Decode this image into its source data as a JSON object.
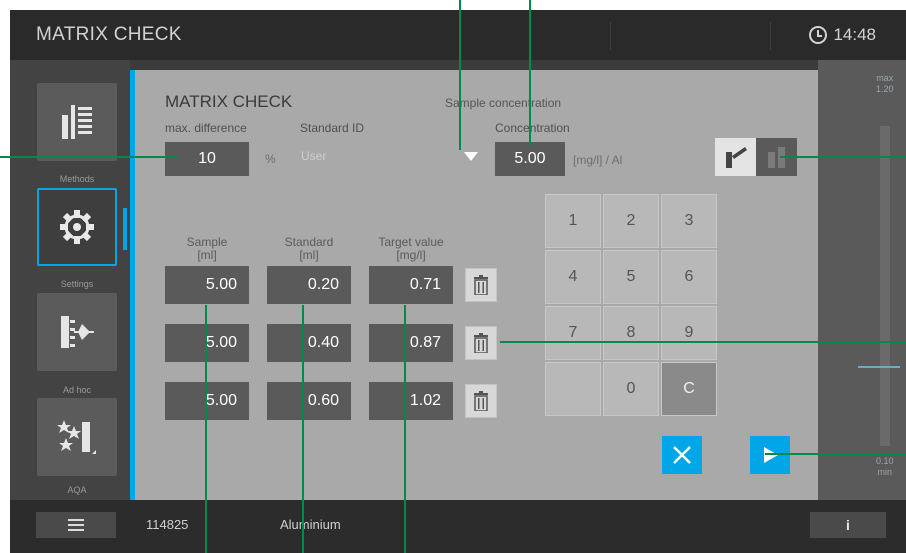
{
  "header": {
    "title": "MATRIX CHECK",
    "time": "14:48"
  },
  "sidebar": {
    "items": [
      {
        "label": "Methods",
        "icon": "methods-icon"
      },
      {
        "label": "Settings",
        "icon": "gear-icon"
      },
      {
        "label": "Ad hoc",
        "icon": "ad-hoc-icon"
      },
      {
        "label": "AQA",
        "icon": "aqa-icon"
      }
    ]
  },
  "panel": {
    "title": "MATRIX CHECK",
    "section": "Sample concentration",
    "max_difference": {
      "label": "max. difference",
      "value": "10",
      "unit": "%"
    },
    "standard_id": {
      "label": "Standard ID",
      "value": "User"
    },
    "concentration": {
      "label": "Concentration",
      "value": "5.00",
      "unit": "[mg/l] / Al"
    },
    "columns": [
      {
        "label": "Sample",
        "unit": "[ml]"
      },
      {
        "label": "Standard",
        "unit": "[ml]"
      },
      {
        "label": "Target value",
        "unit": "[mg/l]"
      }
    ],
    "rows": [
      {
        "sample": "5.00",
        "standard": "0.20",
        "target": "0.71"
      },
      {
        "sample": "5.00",
        "standard": "0.40",
        "target": "0.87"
      },
      {
        "sample": "5.00",
        "standard": "0.60",
        "target": "1.02"
      }
    ]
  },
  "keypad": {
    "keys": [
      "1",
      "2",
      "3",
      "4",
      "5",
      "6",
      "7",
      "8",
      "9",
      "",
      "0",
      "C"
    ]
  },
  "gauge": {
    "max_label": "max",
    "max_value": "1.20",
    "min_label": "min",
    "min_value": "0.10",
    "marker_fraction": 0.25
  },
  "footer": {
    "method_number": "114825",
    "method_name": "Aluminium",
    "info": "i"
  },
  "colors": {
    "accent": "#00a6e8",
    "callout": "#008a4c"
  }
}
